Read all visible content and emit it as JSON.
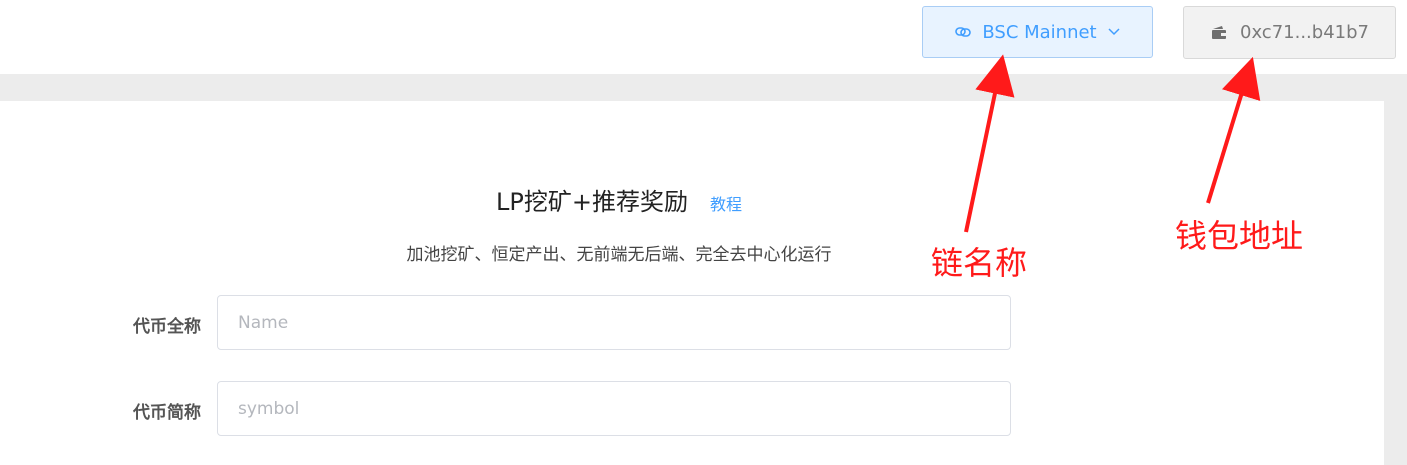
{
  "header": {
    "network_button": {
      "label": "BSC Mainnet",
      "icon": "link-icon",
      "dropdown_icon": "chevron-down-icon"
    },
    "wallet_button": {
      "label": "0xc71...b41b7",
      "icon": "wallet-icon"
    }
  },
  "main": {
    "title": "LP挖矿+推荐奖励",
    "tutorial_link": "教程",
    "subtitle": "加池挖矿、恒定产出、无前端无后端、完全去中心化运行",
    "fields": [
      {
        "label": "代币全称",
        "placeholder": "Name"
      },
      {
        "label": "代币简称",
        "placeholder": "symbol"
      }
    ]
  },
  "annotations": {
    "network_note": "链名称",
    "wallet_note": "钱包地址",
    "color": "#ff1a1a"
  },
  "colors": {
    "accent": "#409eff",
    "background": "#ececec"
  }
}
